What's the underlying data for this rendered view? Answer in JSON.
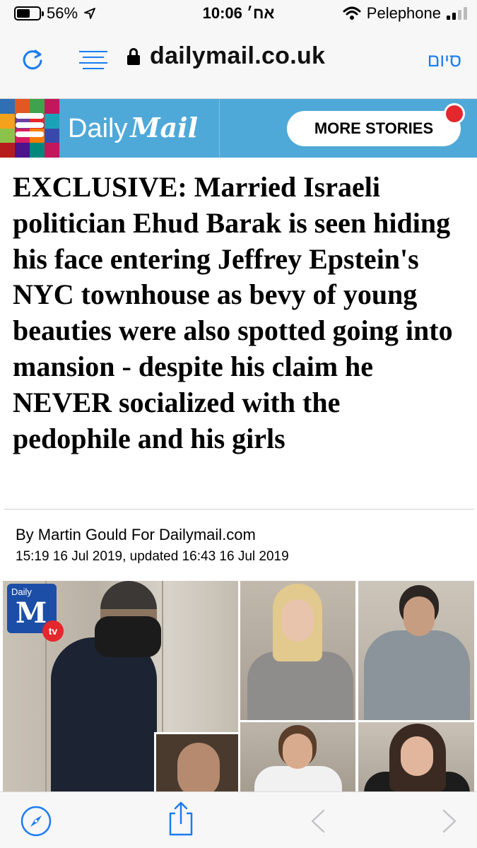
{
  "status_bar": {
    "battery": "56%",
    "time": "אח׳ 10:06",
    "carrier": "Pelephone",
    "icons": [
      "battery-icon",
      "location-arrow-icon",
      "wifi-icon",
      "signal-icon"
    ]
  },
  "address_bar": {
    "domain": "dailymail.co.uk",
    "done_label": "סיום",
    "icons": [
      "reload-icon",
      "reader-icon",
      "lock-icon"
    ],
    "accent_color": "#1a7cf2"
  },
  "site_header": {
    "logo_daily": "Daily",
    "logo_mail": "Mail",
    "more_stories_label": "MORE STORIES",
    "background_color": "#4fa9d8",
    "notification_color": "#e3272d",
    "icons": [
      "menu-icon",
      "notification-dot-icon"
    ]
  },
  "article": {
    "headline": "EXCLUSIVE:  Married Israeli politician Ehud Barak is seen hiding his face entering Jeffrey Epstein's NYC townhouse as bevy of young beauties were also spotted going into mansion - despite his claim he NEVER socialized with the pedophile and his girls",
    "byline": "By Martin Gould For Dailymail.com",
    "dateline": "15:19 16 Jul 2019, updated 16:43 16 Jul 2019",
    "photo_badge": {
      "top": "Daily",
      "letter": "M",
      "tv": "tv"
    }
  },
  "toolbar": {
    "icons": [
      "compass-icon",
      "share-icon",
      "back-arrow-icon",
      "forward-arrow-icon"
    ]
  }
}
